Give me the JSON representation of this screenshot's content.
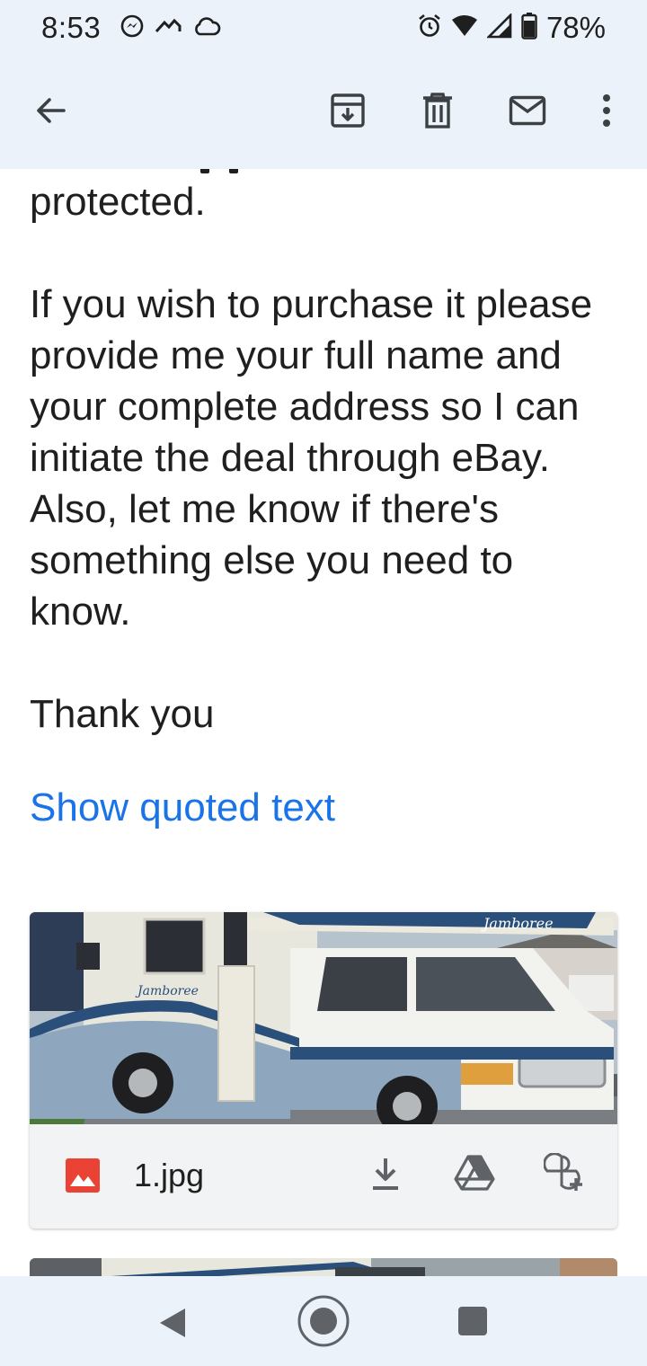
{
  "status_bar": {
    "time": "8:53",
    "battery": "78%",
    "icons": [
      "messenger-icon",
      "arrow-icon",
      "cloud-icon",
      "alarm-icon",
      "wifi-icon",
      "signal-icon",
      "battery-icon"
    ]
  },
  "toolbar": {
    "back_icon": "back-arrow-icon",
    "actions": [
      "archive-icon",
      "delete-icon",
      "mark-unread-icon",
      "more-options-icon"
    ]
  },
  "message": {
    "paragraph_1": "protected.",
    "paragraph_2": "If you wish to purchase it please provide me your full name and your complete address so I can initiate the deal through eBay. Also, let me know if there's something else you need to know.",
    "paragraph_3": "Thank you",
    "show_quoted_text": "Show quoted text"
  },
  "attachments": [
    {
      "filename": "1.jpg",
      "file_type_icon": "image-file-icon",
      "thumbnail_brand": "Jamboree",
      "actions": [
        "download-icon",
        "save-to-drive-icon",
        "add-to-photos-icon"
      ]
    }
  ],
  "nav_bar": {
    "buttons": [
      "back-nav-icon",
      "home-nav-icon",
      "recents-nav-icon"
    ]
  },
  "colors": {
    "bar_background": "#ecf2fa",
    "link": "#1a73e8",
    "text": "#1f1f1f",
    "icon": "#3c4043"
  }
}
